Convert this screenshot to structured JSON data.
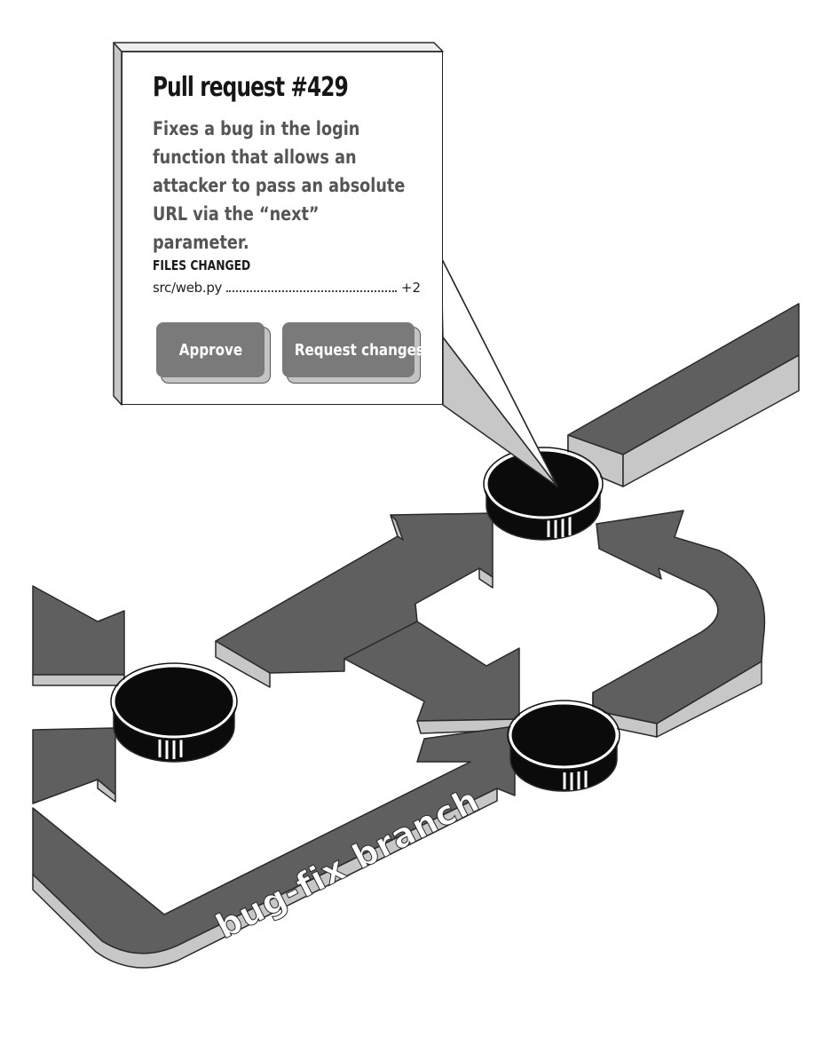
{
  "pull_request": {
    "title": "Pull request #429",
    "description": "Fixes a bug in the login function that allows an attacker to pass an absolute URL via the “next” parameter.",
    "files_changed_heading": "FILES CHANGED",
    "files": [
      {
        "name": "src/web.py",
        "delta": "+2"
      }
    ],
    "actions": {
      "approve_label": "Approve",
      "request_changes_label": "Request changes"
    }
  },
  "diagram": {
    "branch_label": "bug-fix branch",
    "colors": {
      "path_top": "#5f5f5f",
      "path_side": "#c7c7c7",
      "commit_node": "#0b0b0b",
      "outline": "#2a2a2a"
    }
  }
}
